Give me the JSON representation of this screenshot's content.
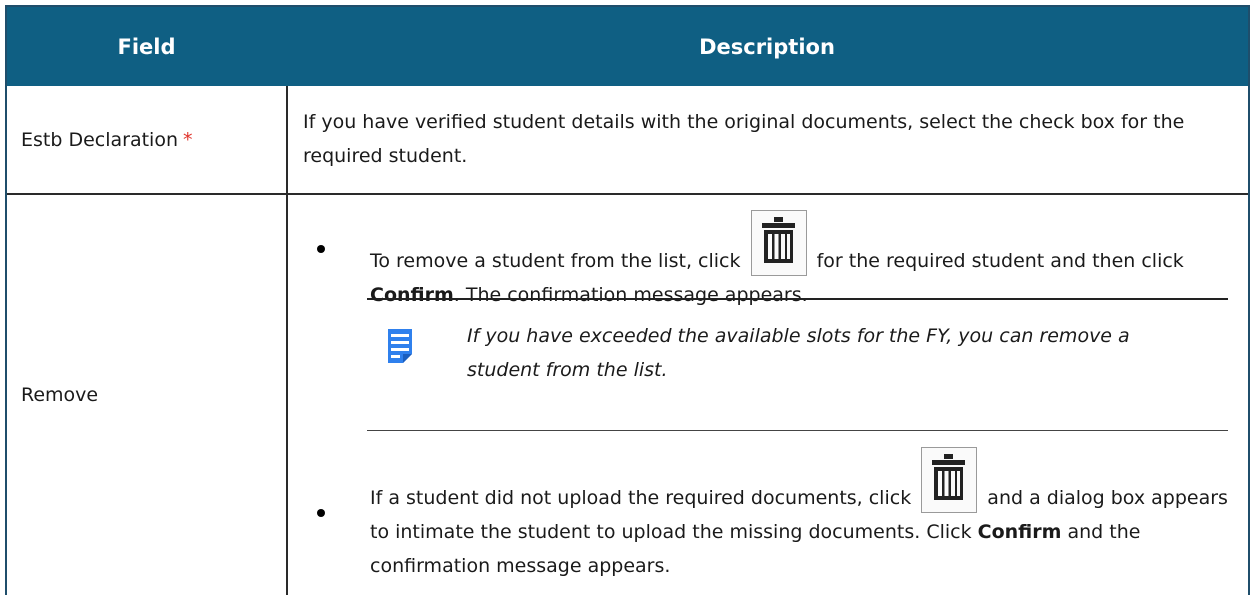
{
  "table": {
    "header": {
      "field": "Field",
      "description": "Description"
    },
    "rows": [
      {
        "field": "Estb Declaration",
        "required_marker": "*",
        "description": "If you have verified student details with the original documents, select the check box for the required student."
      },
      {
        "field": "Remove",
        "bullet1": {
          "text_before_icon": "To remove a student from the list, click",
          "text_after_icon": "for the required student and then click",
          "bold": "Confirm",
          "text_end": ". The confirmation message appears."
        },
        "note": {
          "icon": "note-icon",
          "text": "If you have exceeded the available slots for the FY, you can remove a student from the list."
        },
        "bullet2": {
          "text_before_icon": "If a student did not upload the required documents, click",
          "text_after_icon": "and a dialog box appears to intimate the student to upload the missing documents. Click",
          "bold": "Confirm",
          "text_end": "and the confirmation message appears."
        },
        "action_icon": "trash-icon"
      }
    ]
  },
  "colors": {
    "header_bg": "#0f5f83",
    "header_text": "#ffffff",
    "required_marker": "#e0332b",
    "note_icon": "#2f80ed"
  }
}
